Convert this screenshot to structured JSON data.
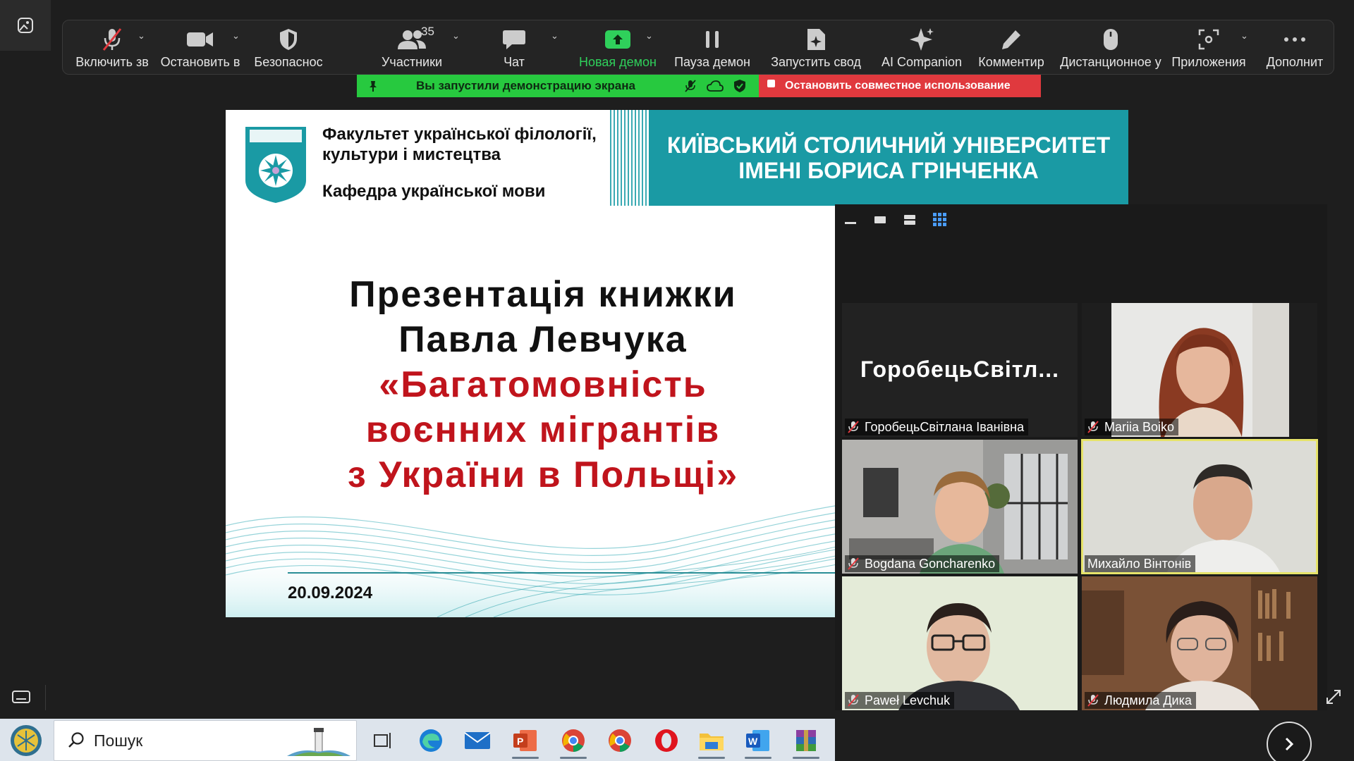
{
  "toolbar": {
    "items": [
      {
        "label": "Включить зв",
        "icon": "microphone-muted-icon"
      },
      {
        "label": "Остановить в",
        "icon": "video-camera-icon"
      },
      {
        "label": "Безопаснос",
        "icon": "shield-icon"
      },
      {
        "label": "Участники",
        "icon": "participants-icon",
        "count": "35"
      },
      {
        "label": "Чат",
        "icon": "chat-icon"
      },
      {
        "label": "Новая демон",
        "icon": "share-screen-icon"
      },
      {
        "label": "Пауза демон",
        "icon": "pause-icon"
      },
      {
        "label": "Запустить свод",
        "icon": "summary-icon"
      },
      {
        "label": "AI Companion",
        "icon": "sparkle-icon"
      },
      {
        "label": "Комментир",
        "icon": "pencil-icon"
      },
      {
        "label": "Дистанционное у",
        "icon": "mouse-icon"
      },
      {
        "label": "Приложения",
        "icon": "apps-icon"
      },
      {
        "label": "Дополнит",
        "icon": "more-icon"
      }
    ]
  },
  "share_banner": {
    "text": "Вы запустили демонстрацию экрана",
    "stop_label": "Остановить совместное использование",
    "color": "#27c93f",
    "stop_color": "#e0393e"
  },
  "slide": {
    "faculty_line1": "Факультет української філології,",
    "faculty_line2": "культури і мистецтва",
    "department": "Кафедра української мови",
    "university_line1": "КИЇВСЬКИЙ СТОЛИЧНИЙ УНІВЕРСИТЕТ",
    "university_line2": "ІМЕНІ БОРИСА ГРІНЧЕНКА",
    "title_line1": "Презентація книжки",
    "title_line2": "Павла Левчука",
    "title_line3": "«Багатомовність",
    "title_line4": "воєнних мігрантів",
    "title_line5": "з України в Польщі»",
    "date": "20.09.2024",
    "accent_color": "#1a9aa4",
    "title_red": "#c0141c"
  },
  "gallery": {
    "participants": [
      {
        "name": "ГоробецьСвітлана Іванівна",
        "display": "ГоробецьСвітл...",
        "muted": true,
        "video": false
      },
      {
        "name": "Mariia Boiko",
        "muted": true,
        "video": true
      },
      {
        "name": "Bogdana Goncharenko",
        "muted": true,
        "video": true
      },
      {
        "name": "Михайло Вінтонів",
        "muted": false,
        "video": true,
        "active_speaker": true
      },
      {
        "name": "Paweł Levchuk",
        "muted": true,
        "video": true
      },
      {
        "name": "Людмила Дика",
        "muted": true,
        "video": true
      }
    ]
  },
  "taskbar": {
    "search_placeholder": "Пошук"
  }
}
